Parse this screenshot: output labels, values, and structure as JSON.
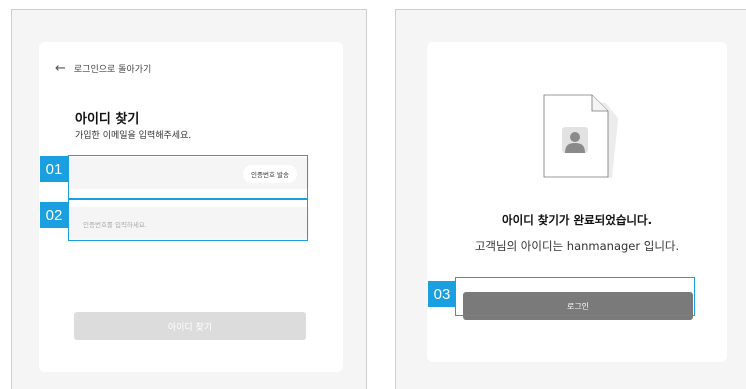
{
  "find_id": {
    "back_label": "로그인으로 돌아가기",
    "title": "아이디 찾기",
    "subtitle": "가입한 이메일을 입력해주세요.",
    "email_placeholder": "",
    "send_code_label": "인증번호 발송",
    "code_placeholder": "인증번호를 입력하세요.",
    "submit_label": "아이디 찾기"
  },
  "result": {
    "title": "아이디 찾기가 완료되었습니다.",
    "description": "고객님의 아이디는 hanmanager 입니다.",
    "login_label": "로그인"
  },
  "annotations": [
    "01",
    "02",
    "03"
  ],
  "colors": {
    "highlight": "#1aa0e0",
    "disabled_button": "#dcdcdc",
    "primary_button": "#7a7a7a"
  }
}
